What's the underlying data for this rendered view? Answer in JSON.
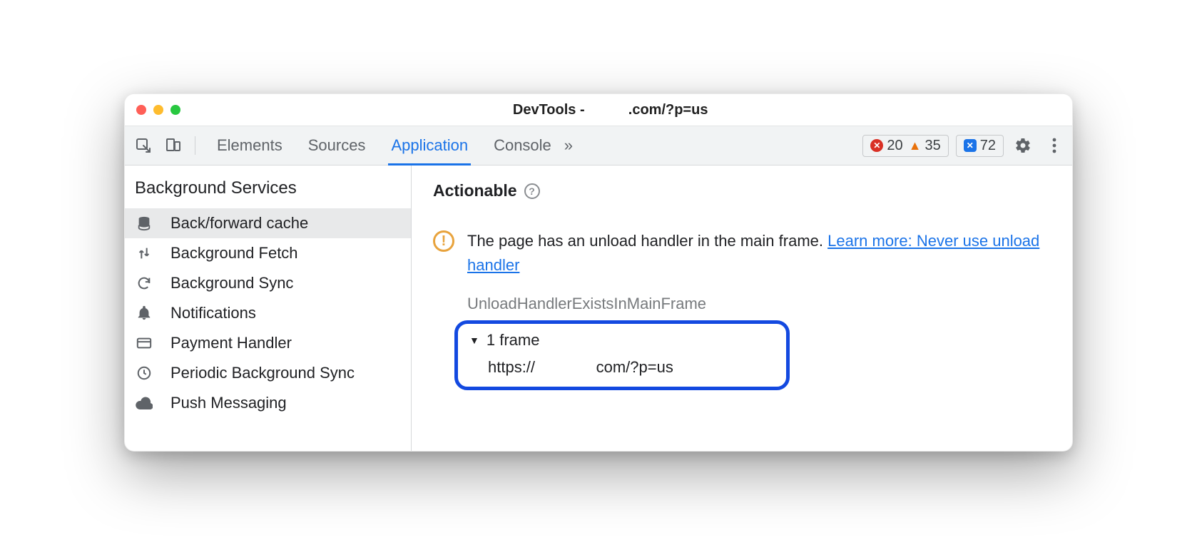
{
  "window": {
    "title_prefix": "DevTools - ",
    "title_domain_hidden": "          ",
    "title_suffix": ".com/?p=us"
  },
  "toolbar": {
    "tabs": [
      "Elements",
      "Sources",
      "Application",
      "Console"
    ],
    "active_tab_index": 2,
    "overflow_glyph": "»",
    "errors": "20",
    "warnings": "35",
    "issues": "72"
  },
  "sidebar": {
    "section_title": "Background Services",
    "items": [
      {
        "label": "Back/forward cache",
        "icon": "database-icon",
        "selected": true
      },
      {
        "label": "Background Fetch",
        "icon": "updown-icon",
        "selected": false
      },
      {
        "label": "Background Sync",
        "icon": "sync-icon",
        "selected": false
      },
      {
        "label": "Notifications",
        "icon": "bell-icon",
        "selected": false
      },
      {
        "label": "Payment Handler",
        "icon": "card-icon",
        "selected": false
      },
      {
        "label": "Periodic Background Sync",
        "icon": "clock-icon",
        "selected": false
      },
      {
        "label": "Push Messaging",
        "icon": "cloud-icon",
        "selected": false
      }
    ]
  },
  "main": {
    "section_title": "Actionable",
    "warning_text": "The page has an unload handler in the main frame. ",
    "learn_more_text": "Learn more: Never use unload handler",
    "reason_id": "UnloadHandlerExistsInMainFrame",
    "frames_summary": "1 frame",
    "frame_url_prefix": "https://",
    "frame_url_hidden": "              ",
    "frame_url_suffix": "com/?p=us"
  }
}
